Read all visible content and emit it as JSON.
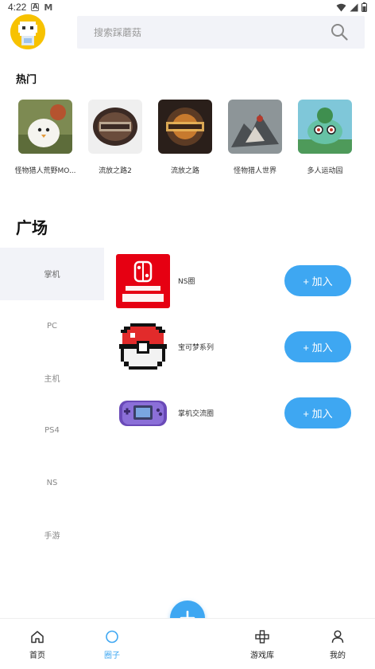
{
  "status_bar": {
    "time": "4:22",
    "badge_a": "A",
    "badge_m": "M"
  },
  "search": {
    "placeholder": "搜索踩蘑菇"
  },
  "hot": {
    "title": "热门",
    "items": [
      {
        "label": "怪物猎人荒野MO...",
        "icon": "game-thumbnail-bird"
      },
      {
        "label": "流放之路2",
        "icon": "game-thumbnail-exile2"
      },
      {
        "label": "流放之路",
        "icon": "game-thumbnail-exile"
      },
      {
        "label": "怪物猎人世界",
        "icon": "game-thumbnail-monster"
      },
      {
        "label": "多人运动园",
        "icon": "game-thumbnail-bulbasaur"
      }
    ]
  },
  "plaza": {
    "title": "广场",
    "categories": [
      {
        "label": "掌机",
        "active": true
      },
      {
        "label": "PC"
      },
      {
        "label": "主机"
      },
      {
        "label": "PS4"
      },
      {
        "label": "NS"
      },
      {
        "label": "手游"
      }
    ],
    "groups": [
      {
        "name": "NS圈",
        "join_label": "+ 加入",
        "icon": "nintendo-switch-logo"
      },
      {
        "name": "宝可梦系列",
        "join_label": "+ 加入",
        "icon": "pokeball-icon"
      },
      {
        "name": "掌机交流圈",
        "join_label": "+ 加入",
        "icon": "gameboy-advance-icon"
      }
    ]
  },
  "tabs": [
    {
      "label": "首页",
      "icon": "home-icon"
    },
    {
      "label": "圈子",
      "icon": "circle-icon",
      "active": true
    },
    {
      "label": "游戏库",
      "icon": "gamepad-icon"
    },
    {
      "label": "我的",
      "icon": "person-icon"
    }
  ],
  "colors": {
    "accent": "#3ea7f2",
    "search_bg": "#f2f3f8",
    "avatar_bg": "#f7c200",
    "switch_red": "#e60012"
  }
}
